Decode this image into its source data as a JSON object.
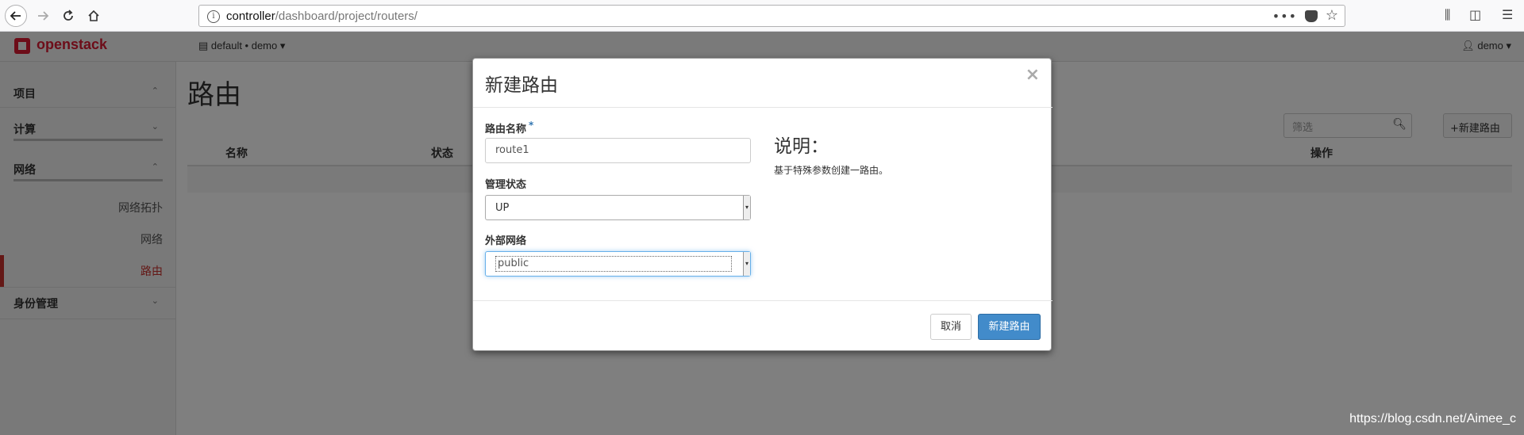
{
  "browser": {
    "url_host": "controller",
    "url_path": "/dashboard/project/routers/",
    "info_icon": "i",
    "more_dots": "•••"
  },
  "header": {
    "logo_text": "openstack",
    "project_switcher": "default • demo ▾",
    "user_menu": "demo ▾"
  },
  "sidebar": {
    "sections": {
      "project": "项目",
      "compute": "计算",
      "network": "网络",
      "identity": "身份管理"
    },
    "items": {
      "topology": "网络拓扑",
      "networks": "网络",
      "routers": "路由"
    }
  },
  "main": {
    "title": "路由",
    "filter_placeholder": "筛选",
    "create_button": "新建路由",
    "columns": [
      "名称",
      "状态",
      "操作"
    ]
  },
  "modal": {
    "title": "新建路由",
    "close": "×",
    "router_name_label": "路由名称",
    "required_mark": "*",
    "router_name_value": "route1",
    "admin_state_label": "管理状态",
    "admin_state_value": "UP",
    "external_network_label": "外部网络",
    "external_network_value": "public",
    "description_title": "说明：",
    "description_text": "基于特殊参数创建一路由。",
    "cancel_button": "取消",
    "submit_button": "新建路由"
  },
  "watermark": "https://blog.csdn.net/Aimee_c",
  "colors": {
    "brand": "#da1a32",
    "primary": "#428bca",
    "active_nav": "#c9302c"
  }
}
